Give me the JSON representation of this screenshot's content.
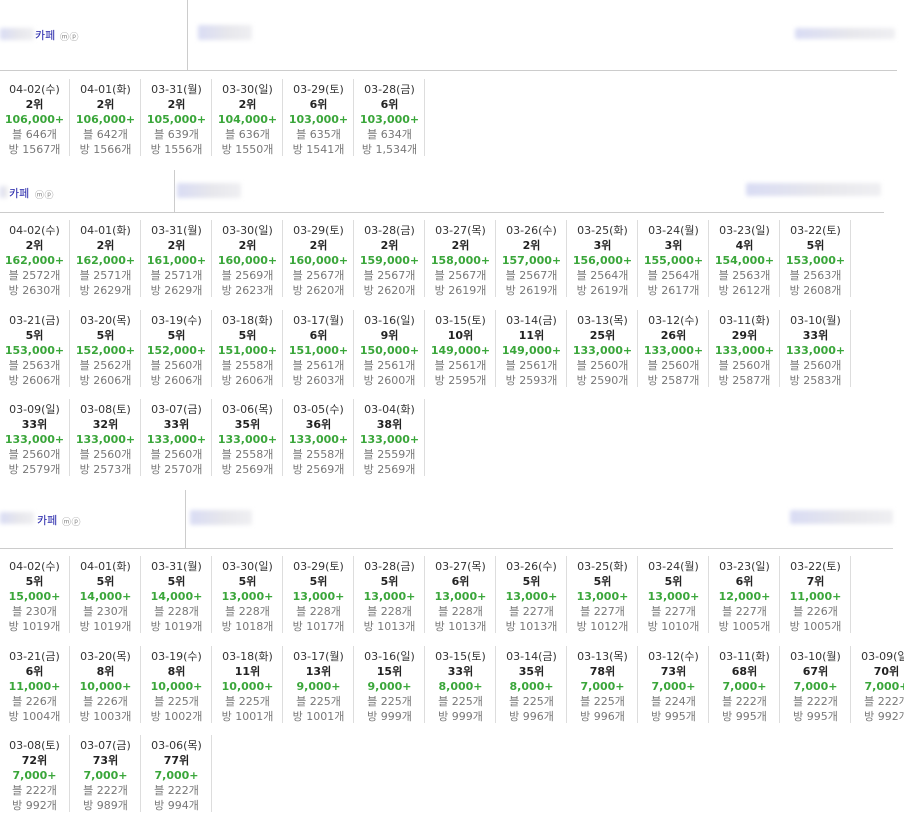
{
  "sections": [
    {
      "cafe_label": "카페",
      "mp_label": "ⓜⓟ",
      "rows": [
        [
          {
            "date": "04-02(수)",
            "rank": "2위",
            "views": "106,000+",
            "blog": "블 646개",
            "room": "방 1567개"
          },
          {
            "date": "04-01(화)",
            "rank": "2위",
            "views": "106,000+",
            "blog": "블 642개",
            "room": "방 1566개"
          },
          {
            "date": "03-31(월)",
            "rank": "2위",
            "views": "105,000+",
            "blog": "블 639개",
            "room": "방 1556개"
          },
          {
            "date": "03-30(일)",
            "rank": "2위",
            "views": "104,000+",
            "blog": "블 636개",
            "room": "방 1550개"
          },
          {
            "date": "03-29(토)",
            "rank": "6위",
            "views": "103,000+",
            "blog": "블 635개",
            "room": "방 1541개"
          },
          {
            "date": "03-28(금)",
            "rank": "6위",
            "views": "103,000+",
            "blog": "블 634개",
            "room": "방 1,534개"
          }
        ]
      ]
    },
    {
      "cafe_label": "카페",
      "mp_label": "ⓜⓟ",
      "rows": [
        [
          {
            "date": "04-02(수)",
            "rank": "2위",
            "views": "162,000+",
            "blog": "블 2572개",
            "room": "방 2630개"
          },
          {
            "date": "04-01(화)",
            "rank": "2위",
            "views": "162,000+",
            "blog": "블 2571개",
            "room": "방 2629개"
          },
          {
            "date": "03-31(월)",
            "rank": "2위",
            "views": "161,000+",
            "blog": "블 2571개",
            "room": "방 2629개"
          },
          {
            "date": "03-30(일)",
            "rank": "2위",
            "views": "160,000+",
            "blog": "블 2569개",
            "room": "방 2623개"
          },
          {
            "date": "03-29(토)",
            "rank": "2위",
            "views": "160,000+",
            "blog": "블 2567개",
            "room": "방 2620개"
          },
          {
            "date": "03-28(금)",
            "rank": "2위",
            "views": "159,000+",
            "blog": "블 2567개",
            "room": "방 2620개"
          },
          {
            "date": "03-27(목)",
            "rank": "2위",
            "views": "158,000+",
            "blog": "블 2567개",
            "room": "방 2619개"
          },
          {
            "date": "03-26(수)",
            "rank": "2위",
            "views": "157,000+",
            "blog": "블 2567개",
            "room": "방 2619개"
          },
          {
            "date": "03-25(화)",
            "rank": "3위",
            "views": "156,000+",
            "blog": "블 2564개",
            "room": "방 2619개"
          },
          {
            "date": "03-24(월)",
            "rank": "3위",
            "views": "155,000+",
            "blog": "블 2564개",
            "room": "방 2617개"
          },
          {
            "date": "03-23(일)",
            "rank": "4위",
            "views": "154,000+",
            "blog": "블 2563개",
            "room": "방 2612개"
          },
          {
            "date": "03-22(토)",
            "rank": "5위",
            "views": "153,000+",
            "blog": "블 2563개",
            "room": "방 2608개"
          }
        ],
        [
          {
            "date": "03-21(금)",
            "rank": "5위",
            "views": "153,000+",
            "blog": "블 2563개",
            "room": "방 2606개"
          },
          {
            "date": "03-20(목)",
            "rank": "5위",
            "views": "152,000+",
            "blog": "블 2562개",
            "room": "방 2606개"
          },
          {
            "date": "03-19(수)",
            "rank": "5위",
            "views": "152,000+",
            "blog": "블 2560개",
            "room": "방 2606개"
          },
          {
            "date": "03-18(화)",
            "rank": "5위",
            "views": "151,000+",
            "blog": "블 2558개",
            "room": "방 2606개"
          },
          {
            "date": "03-17(월)",
            "rank": "6위",
            "views": "151,000+",
            "blog": "블 2561개",
            "room": "방 2603개"
          },
          {
            "date": "03-16(일)",
            "rank": "9위",
            "views": "150,000+",
            "blog": "블 2561개",
            "room": "방 2600개"
          },
          {
            "date": "03-15(토)",
            "rank": "10위",
            "views": "149,000+",
            "blog": "블 2561개",
            "room": "방 2595개"
          },
          {
            "date": "03-14(금)",
            "rank": "11위",
            "views": "149,000+",
            "blog": "블 2561개",
            "room": "방 2593개"
          },
          {
            "date": "03-13(목)",
            "rank": "25위",
            "views": "133,000+",
            "blog": "블 2560개",
            "room": "방 2590개"
          },
          {
            "date": "03-12(수)",
            "rank": "26위",
            "views": "133,000+",
            "blog": "블 2560개",
            "room": "방 2587개"
          },
          {
            "date": "03-11(화)",
            "rank": "29위",
            "views": "133,000+",
            "blog": "블 2560개",
            "room": "방 2587개"
          },
          {
            "date": "03-10(월)",
            "rank": "33위",
            "views": "133,000+",
            "blog": "블 2560개",
            "room": "방 2583개"
          }
        ],
        [
          {
            "date": "03-09(일)",
            "rank": "33위",
            "views": "133,000+",
            "blog": "블 2560개",
            "room": "방 2579개"
          },
          {
            "date": "03-08(토)",
            "rank": "32위",
            "views": "133,000+",
            "blog": "블 2560개",
            "room": "방 2573개"
          },
          {
            "date": "03-07(금)",
            "rank": "33위",
            "views": "133,000+",
            "blog": "블 2560개",
            "room": "방 2570개"
          },
          {
            "date": "03-06(목)",
            "rank": "35위",
            "views": "133,000+",
            "blog": "블 2558개",
            "room": "방 2569개"
          },
          {
            "date": "03-05(수)",
            "rank": "36위",
            "views": "133,000+",
            "blog": "블 2558개",
            "room": "방 2569개"
          },
          {
            "date": "03-04(화)",
            "rank": "38위",
            "views": "133,000+",
            "blog": "블 2559개",
            "room": "방 2569개"
          }
        ]
      ]
    },
    {
      "cafe_label": "카페",
      "mp_label": "ⓜⓟ",
      "rows": [
        [
          {
            "date": "04-02(수)",
            "rank": "5위",
            "views": "15,000+",
            "blog": "블 230개",
            "room": "방 1019개"
          },
          {
            "date": "04-01(화)",
            "rank": "5위",
            "views": "14,000+",
            "blog": "블 230개",
            "room": "방 1019개"
          },
          {
            "date": "03-31(월)",
            "rank": "5위",
            "views": "14,000+",
            "blog": "블 228개",
            "room": "방 1019개"
          },
          {
            "date": "03-30(일)",
            "rank": "5위",
            "views": "13,000+",
            "blog": "블 228개",
            "room": "방 1018개"
          },
          {
            "date": "03-29(토)",
            "rank": "5위",
            "views": "13,000+",
            "blog": "블 228개",
            "room": "방 1017개"
          },
          {
            "date": "03-28(금)",
            "rank": "5위",
            "views": "13,000+",
            "blog": "블 228개",
            "room": "방 1013개"
          },
          {
            "date": "03-27(목)",
            "rank": "6위",
            "views": "13,000+",
            "blog": "블 228개",
            "room": "방 1013개"
          },
          {
            "date": "03-26(수)",
            "rank": "5위",
            "views": "13,000+",
            "blog": "블 227개",
            "room": "방 1013개"
          },
          {
            "date": "03-25(화)",
            "rank": "5위",
            "views": "13,000+",
            "blog": "블 227개",
            "room": "방 1012개"
          },
          {
            "date": "03-24(월)",
            "rank": "5위",
            "views": "13,000+",
            "blog": "블 227개",
            "room": "방 1010개"
          },
          {
            "date": "03-23(일)",
            "rank": "6위",
            "views": "12,000+",
            "blog": "블 227개",
            "room": "방 1005개"
          },
          {
            "date": "03-22(토)",
            "rank": "7위",
            "views": "11,000+",
            "blog": "블 226개",
            "room": "방 1005개"
          }
        ],
        [
          {
            "date": "03-21(금)",
            "rank": "6위",
            "views": "11,000+",
            "blog": "블 226개",
            "room": "방 1004개"
          },
          {
            "date": "03-20(목)",
            "rank": "8위",
            "views": "10,000+",
            "blog": "블 226개",
            "room": "방 1003개"
          },
          {
            "date": "03-19(수)",
            "rank": "8위",
            "views": "10,000+",
            "blog": "블 225개",
            "room": "방 1002개"
          },
          {
            "date": "03-18(화)",
            "rank": "11위",
            "views": "10,000+",
            "blog": "블 225개",
            "room": "방 1001개"
          },
          {
            "date": "03-17(월)",
            "rank": "13위",
            "views": "9,000+",
            "blog": "블 225개",
            "room": "방 1001개"
          },
          {
            "date": "03-16(일)",
            "rank": "15위",
            "views": "9,000+",
            "blog": "블 225개",
            "room": "방 999개"
          },
          {
            "date": "03-15(토)",
            "rank": "33위",
            "views": "8,000+",
            "blog": "블 225개",
            "room": "방 999개"
          },
          {
            "date": "03-14(금)",
            "rank": "35위",
            "views": "8,000+",
            "blog": "블 225개",
            "room": "방 996개"
          },
          {
            "date": "03-13(목)",
            "rank": "78위",
            "views": "7,000+",
            "blog": "블 225개",
            "room": "방 996개"
          },
          {
            "date": "03-12(수)",
            "rank": "73위",
            "views": "7,000+",
            "blog": "블 224개",
            "room": "방 995개"
          },
          {
            "date": "03-11(화)",
            "rank": "68위",
            "views": "7,000+",
            "blog": "블 222개",
            "room": "방 995개"
          },
          {
            "date": "03-10(월)",
            "rank": "67위",
            "views": "7,000+",
            "blog": "블 222개",
            "room": "방 995개"
          },
          {
            "date": "03-09(일)",
            "rank": "70위",
            "views": "7,000+",
            "blog": "블 222개",
            "room": "방 992개"
          }
        ],
        [
          {
            "date": "03-08(토)",
            "rank": "72위",
            "views": "7,000+",
            "blog": "블 222개",
            "room": "방 992개"
          },
          {
            "date": "03-07(금)",
            "rank": "73위",
            "views": "7,000+",
            "blog": "블 222개",
            "room": "방 989개"
          },
          {
            "date": "03-06(목)",
            "rank": "77위",
            "views": "7,000+",
            "blog": "블 222개",
            "room": "방 994개"
          }
        ]
      ]
    }
  ]
}
